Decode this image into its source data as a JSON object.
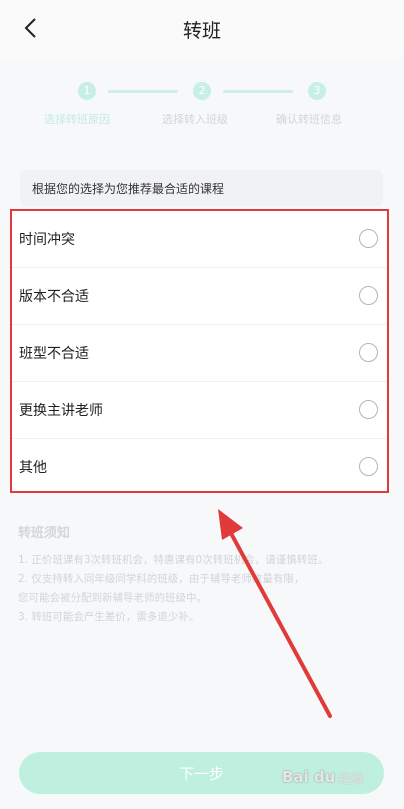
{
  "header": {
    "title": "转班"
  },
  "stepper": {
    "steps": [
      {
        "number": "1",
        "label": "选择转班原因"
      },
      {
        "number": "2",
        "label": "选择转入班级"
      },
      {
        "number": "3",
        "label": "确认转班信息"
      }
    ]
  },
  "hint": {
    "text": "根据您的选择为您推荐最合适的课程"
  },
  "options": [
    {
      "label": "时间冲突"
    },
    {
      "label": "版本不合适"
    },
    {
      "label": "班型不合适"
    },
    {
      "label": "更换主讲老师"
    },
    {
      "label": "其他"
    }
  ],
  "notice": {
    "title": "转班须知",
    "lines": [
      "1. 正价班课有3次转班机会，特惠课有0次转班机会，请谨慎转班。",
      "2. 仅支持转入同年级同学科的班级，由于辅导老师数量有限，",
      "您可能会被分配到新辅导老师的班级中。",
      "3. 转班可能会产生差价，需多退少补。"
    ]
  },
  "footer": {
    "next_label": "下一步"
  },
  "watermark": {
    "logo": "Bai du",
    "label": "经验"
  },
  "colors": {
    "accent": "#3cc99a",
    "highlight_border": "#e03a3a",
    "arrow": "#e03a3a"
  }
}
